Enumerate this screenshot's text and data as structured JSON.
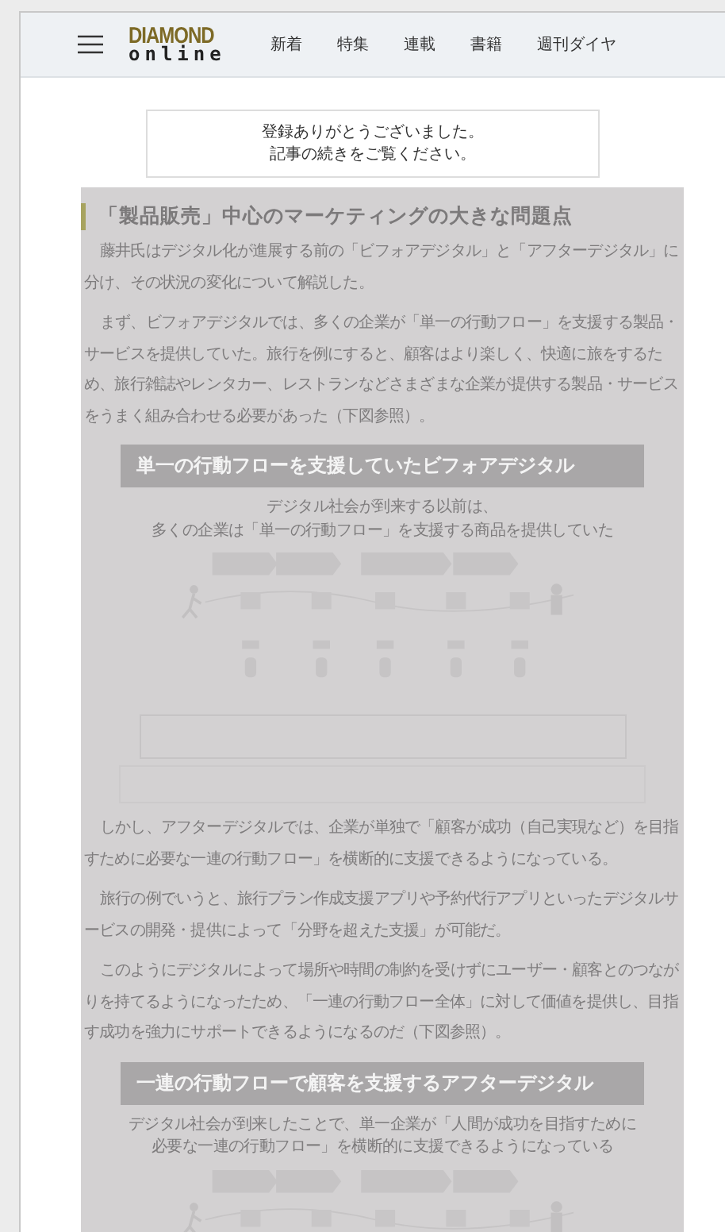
{
  "header": {
    "logo_top": "DIAMOND",
    "logo_bottom": "online",
    "nav": [
      "新着",
      "特集",
      "連載",
      "書籍",
      "週刊ダイヤ"
    ]
  },
  "notice": [
    "登録ありがとうございました。",
    "記事の続きをご覧ください。"
  ],
  "article": {
    "heading": "「製品販売」中心のマーケティングの大きな問題点",
    "blocks": [
      {
        "kind": "paragraph",
        "text": "藤井氏はデジタル化が進展する前の「ビフォアデジタル」と「アフターデジタル」に分け、その状況の変化について解説した。"
      },
      {
        "kind": "paragraph",
        "text": "まず、ビフォアデジタルでは、多くの企業が「単一の行動フロー」を支援する製品・サービスを提供していた。旅行を例にすると、顧客はより楽しく、快適に旅をするため、旅行雑誌やレンタカー、レストランなどさまざまな企業が提供する製品・サービスをうまく組み合わせる必要があった（下図参照）。"
      },
      {
        "kind": "figure",
        "banner": "単一の行動フローを支援していたビフォアデジタル",
        "caption": [
          "デジタル社会が到来する以前は、",
          "多くの企業は「単一の行動フロー」を支援する商品を提供していた"
        ]
      },
      {
        "kind": "paragraph",
        "text": "しかし、アフターデジタルでは、企業が単独で「顧客が成功（自己実現など）を目指すために必要な一連の行動フロー」を横断的に支援できるようになっている。"
      },
      {
        "kind": "paragraph",
        "text": "旅行の例でいうと、旅行プラン作成支援アプリや予約代行アプリといったデジタルサービスの開発・提供によって「分野を超えた支援」が可能だ。"
      },
      {
        "kind": "paragraph",
        "text": "このようにデジタルによって場所や時間の制約を受けずにユーザー・顧客とのつながりを持てるようになったため、「一連の行動フロー全体」に対して価値を提供し、目指す成功を強力にサポートできるようになるのだ（下図参照）。"
      },
      {
        "kind": "figure",
        "banner": "一連の行動フローで顧客を支援するアフターデジタル",
        "caption": [
          "デジタル社会が到来したことで、単一企業が「人間が成功を目指すために",
          "必要な一連の行動フロー」を横断的に支援できるようになっている"
        ]
      }
    ]
  }
}
